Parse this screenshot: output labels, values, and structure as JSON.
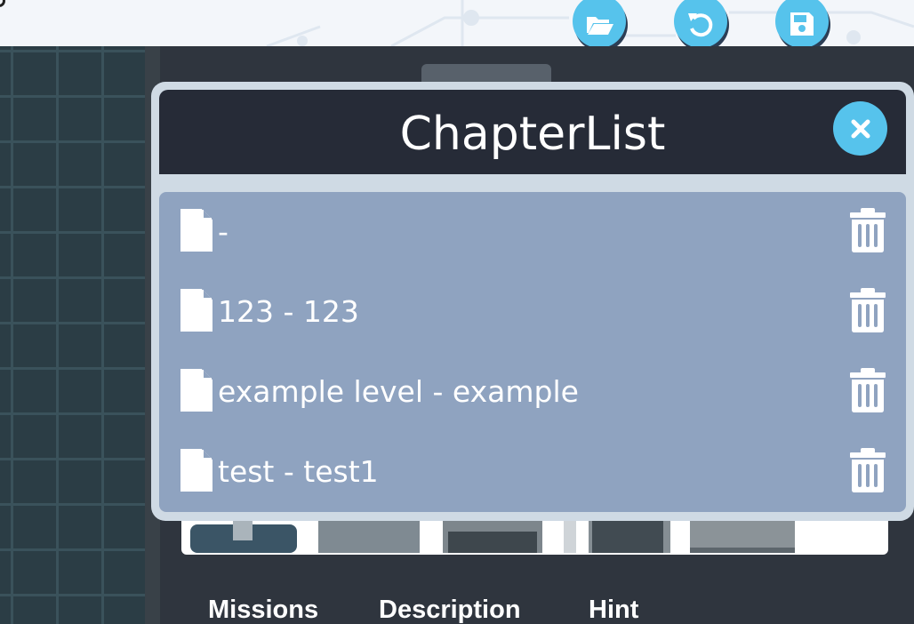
{
  "toolbar": {
    "buttons": [
      {
        "name": "open-folder-icon"
      },
      {
        "name": "undo-icon"
      },
      {
        "name": "save-icon"
      }
    ]
  },
  "colors": {
    "accent": "#56c3ec",
    "header_bg": "#262b37",
    "list_bg": "#8fa3c0",
    "modal_frame": "#cfdae4",
    "panel_bg": "#2f353e"
  },
  "modal": {
    "title": "ChapterList",
    "close_icon": "close-icon",
    "items": [
      {
        "label": " -",
        "icon": "file-icon",
        "action_icon": "trash-icon"
      },
      {
        "label": "123 - 123",
        "icon": "file-icon",
        "action_icon": "trash-icon"
      },
      {
        "label": "example level - example",
        "icon": "file-icon",
        "action_icon": "trash-icon"
      },
      {
        "label": "test - test1",
        "icon": "file-icon",
        "action_icon": "trash-icon"
      }
    ]
  },
  "editor": {
    "tabs": [
      {
        "label": "Missions"
      },
      {
        "label": "Description"
      },
      {
        "label": "Hint"
      }
    ]
  }
}
